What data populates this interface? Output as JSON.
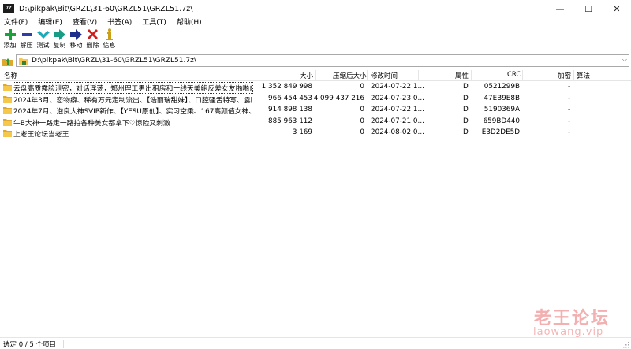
{
  "window": {
    "app_icon_text": "7Z",
    "title": "D:\\pikpak\\Bit\\GRZL\\31-60\\GRZL51\\GRZL51.7z\\",
    "controls": [
      "—",
      "☐",
      "✕"
    ]
  },
  "menu": [
    "文件(F)",
    "编辑(E)",
    "查看(V)",
    "书签(A)",
    "工具(T)",
    "帮助(H)"
  ],
  "toolbar": [
    {
      "label": "添加",
      "icon": "plus-icon",
      "color": "#1aa33a"
    },
    {
      "label": "解压",
      "icon": "minus-icon",
      "color": "#2e3ea8"
    },
    {
      "label": "测试",
      "icon": "check-icon",
      "color": "#1da9b6"
    },
    {
      "label": "复制",
      "icon": "copy-arrow-icon",
      "color": "#179c86"
    },
    {
      "label": "移动",
      "icon": "move-arrow-icon",
      "color": "#1d2f8c"
    },
    {
      "label": "删除",
      "icon": "delete-x-icon",
      "color": "#d01d1d"
    },
    {
      "label": "信息",
      "icon": "info-icon",
      "color": "#c9a017"
    }
  ],
  "address": {
    "path": "D:\\pikpak\\Bit\\GRZL\\31-60\\GRZL51\\GRZL51.7z\\"
  },
  "columns": {
    "name": "名称",
    "size": "大小",
    "packed": "压缩后大小",
    "modified": "修改时间",
    "attr": "属性",
    "crc": "CRC",
    "encrypted": "加密",
    "method": "算法"
  },
  "rows": [
    {
      "name": "云盘高质露脸泄密，对话淫荡，郑州理工男出租房和一线天美鲍反差女友啪啪自拍流出",
      "size": "1 352 849 998",
      "packed": "0",
      "modified": "2024-07-22 1...",
      "attr": "D",
      "crc": "0521299B",
      "encrypted": "-"
    },
    {
      "name": "2024年3月、恋物癖、稀有万元定制流出、【浩丽瑞甜妹】、口腔骚舌特写、露脸脱衣...",
      "size": "966 454 453",
      "packed": "4 099 437 216",
      "modified": "2024-07-23 0...",
      "attr": "D",
      "crc": "47EB9E8B",
      "encrypted": "-"
    },
    {
      "name": "2024年7月、泡良大神SVIP新作、【YESU原创】、实习空乘、167高颜值女神、完美腰臀...",
      "size": "914 898 138",
      "packed": "0",
      "modified": "2024-07-22 1...",
      "attr": "D",
      "crc": "5190369A",
      "encrypted": "-"
    },
    {
      "name": "牛B大神一路走一路拍各种美女都拿下♡惊险又刺激",
      "size": "885 963 112",
      "packed": "0",
      "modified": "2024-07-21 0...",
      "attr": "D",
      "crc": "659BD440",
      "encrypted": "-"
    },
    {
      "name": "上老王论坛当老王",
      "size": "3 169",
      "packed": "0",
      "modified": "2024-08-02 0...",
      "attr": "D",
      "crc": "E3D2DE5D",
      "encrypted": "-"
    }
  ],
  "watermark": {
    "line1": "老王论坛",
    "line2": "laowang.vip"
  },
  "status": "选定 0 / 5 个项目",
  "colors": {
    "folder": "#f5c74c",
    "folder_dark": "#e0a92b",
    "watermark": "#f2b0b0"
  }
}
